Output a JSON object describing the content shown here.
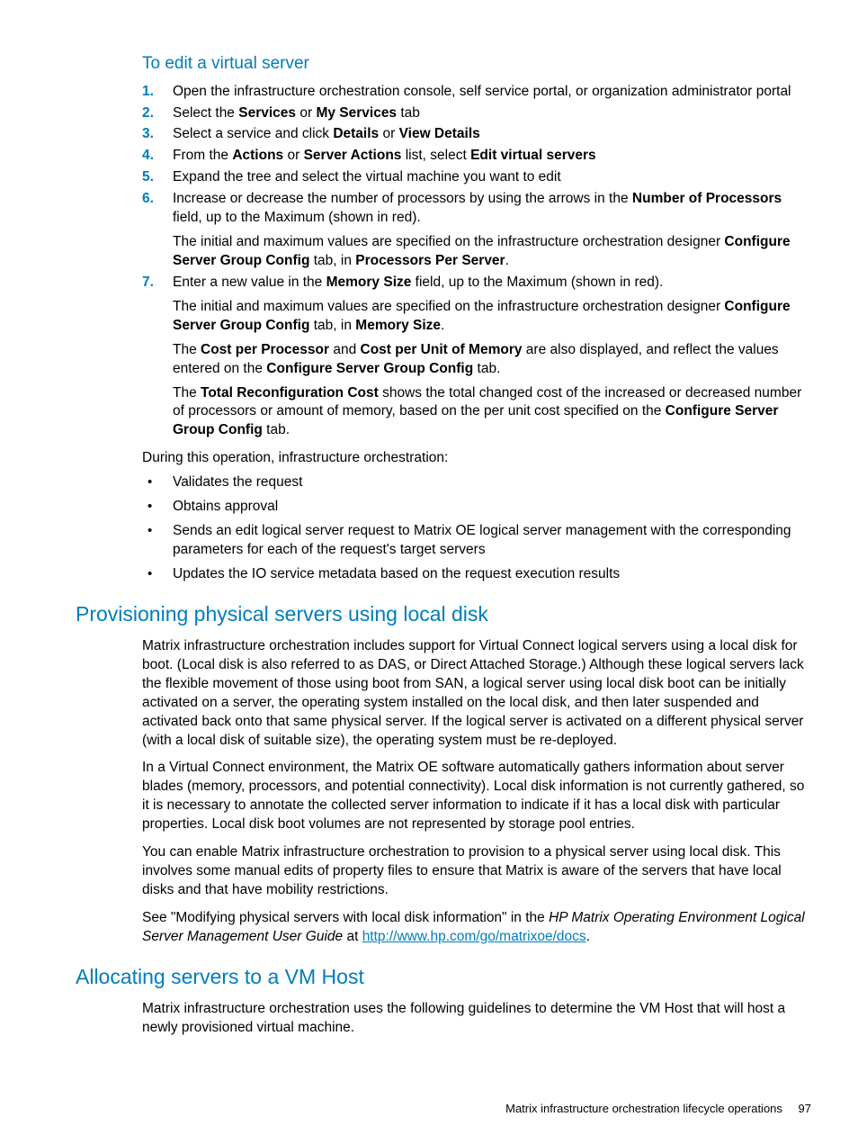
{
  "heading_edit": "To edit a virtual server",
  "steps": {
    "s1": "Open the infrastructure orchestration console, self service portal, or organization administrator portal",
    "s2_a": "Select the ",
    "s2_b1": "Services",
    "s2_c": " or ",
    "s2_b2": "My Services",
    "s2_d": " tab",
    "s3_a": "Select a service and click ",
    "s3_b1": "Details",
    "s3_c": " or ",
    "s3_b2": "View Details",
    "s4_a": "From the ",
    "s4_b1": "Actions",
    "s4_c": " or ",
    "s4_b2": "Server Actions",
    "s4_d": " list, select ",
    "s4_b3": "Edit virtual servers",
    "s5": "Expand the tree and select the virtual machine you want to edit",
    "s6_a": "Increase or decrease the number of processors by using the arrows in the ",
    "s6_b1": "Number of Processors",
    "s6_c": " field, up to the Maximum (shown in red).",
    "s6_p2a": "The initial and maximum values are specified on the infrastructure orchestration designer ",
    "s6_p2b1": "Configure Server Group Config",
    "s6_p2c": " tab, in ",
    "s6_p2b2": "Processors Per Server",
    "s6_p2d": ".",
    "s7_a": "Enter a new value in the ",
    "s7_b1": "Memory Size",
    "s7_c": " field, up to the Maximum (shown in red).",
    "s7_p2a": "The initial and maximum values are specified on the infrastructure orchestration designer ",
    "s7_p2b1": "Configure Server Group Config",
    "s7_p2c": " tab, in ",
    "s7_p2b2": "Memory Size",
    "s7_p2d": ".",
    "s7_p3a": "The ",
    "s7_p3b1": "Cost per Processor",
    "s7_p3c": " and ",
    "s7_p3b2": "Cost per Unit of Memory",
    "s7_p3d": " are also displayed, and reflect the values entered on the ",
    "s7_p3b3": "Configure Server Group Config",
    "s7_p3e": " tab.",
    "s7_p4a": "The ",
    "s7_p4b1": "Total Reconfiguration Cost",
    "s7_p4c": " shows the total changed cost of the increased or decreased number of processors or amount of memory, based on the per unit cost specified on the ",
    "s7_p4b2": "Configure Server Group Config",
    "s7_p4d": " tab."
  },
  "during_intro": "During this operation, infrastructure orchestration:",
  "during": {
    "b1": "Validates the request",
    "b2": "Obtains approval",
    "b3": "Sends an edit logical server request to Matrix OE logical server management with the corresponding parameters for each of the request's target servers",
    "b4": "Updates the IO service metadata based on the request execution results"
  },
  "heading_provision": "Provisioning physical servers using local disk",
  "prov": {
    "p1": "Matrix infrastructure orchestration includes support for Virtual Connect logical servers using a local disk for boot. (Local disk is also referred to as DAS, or Direct Attached Storage.) Although these logical servers lack the flexible movement of those using boot from SAN, a logical server using local disk boot can be initially activated on a server, the operating system installed on the local disk, and then later suspended and activated back onto that same physical server. If the logical server is activated on a different physical server (with a local disk of suitable size), the operating system must be re-deployed.",
    "p2": "In a Virtual Connect environment, the Matrix OE software automatically gathers information about server blades (memory, processors, and potential connectivity). Local disk information is not currently gathered, so it is necessary to annotate the collected server information to indicate if it has a local disk with particular properties. Local disk boot volumes are not represented by storage pool entries.",
    "p3": "You can enable Matrix infrastructure orchestration to provision to a physical server using local disk. This involves some manual edits of property files to ensure that Matrix is aware of the servers that have local disks and that have mobility restrictions.",
    "p4a": "See \"Modifying physical servers with local disk information\" in the ",
    "p4i": "HP Matrix Operating Environment Logical Server Management User Guide",
    "p4b": " at ",
    "p4link": "http://www.hp.com/go/matrixoe/docs",
    "p4c": "."
  },
  "heading_alloc": "Allocating servers to a VM Host",
  "alloc_p1": "Matrix infrastructure orchestration uses the following guidelines to determine the VM Host that will host a newly provisioned virtual machine.",
  "footer_text": "Matrix infrastructure orchestration lifecycle operations",
  "page_number": "97"
}
